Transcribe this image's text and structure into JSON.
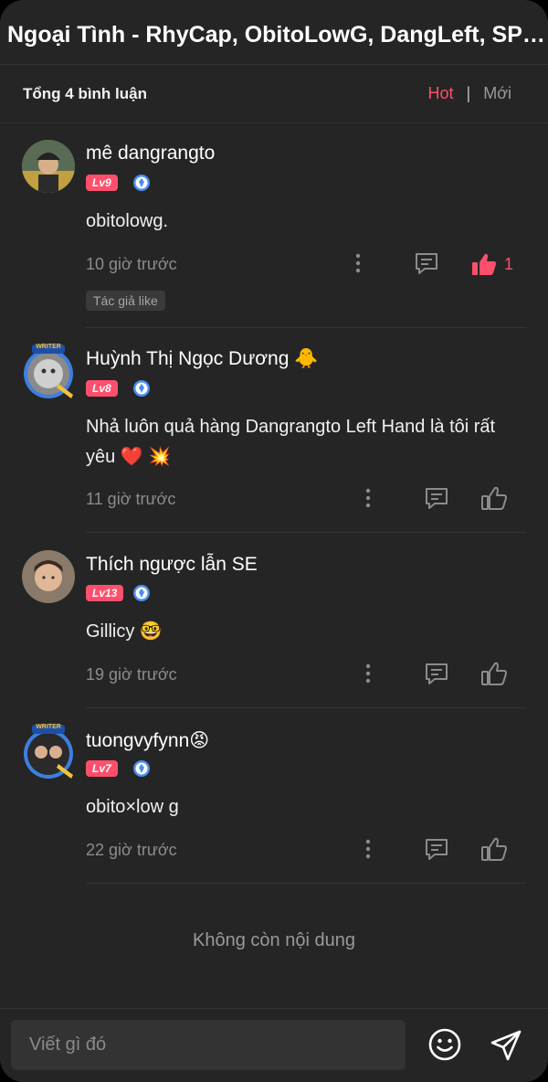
{
  "header": {
    "title": "Ngoại Tình - RhyCap, ObitoLowG, DangLeft, SPIDEYBOY"
  },
  "toolbar": {
    "count_label": "Tổng 4 bình luận",
    "sort_hot": "Hot",
    "sort_sep": "|",
    "sort_new": "Mới"
  },
  "comments": [
    {
      "name": "mê dangrangto",
      "level": "Lv9",
      "text": "obitolowg.",
      "time": "10 giờ trước",
      "like_count": "1",
      "liked": true,
      "author_tag": "Tác giả like"
    },
    {
      "name": "Huỳnh Thị Ngọc Dương 🐥",
      "level": "Lv8",
      "text": "Nhả luôn quả hàng Dangrangto Left Hand là tôi rất yêu ❤️ 💥",
      "time": "11 giờ trước",
      "liked": false,
      "avatar_badge": "WRITER"
    },
    {
      "name": "Thích ngược lẫn SE",
      "level": "Lv13",
      "text": "Gillicy 🤓",
      "time": "19 giờ trước",
      "liked": false
    },
    {
      "name": "tuongvyfynn😡",
      "level": "Lv7",
      "text": "obito×low g",
      "time": "22 giờ trước",
      "liked": false,
      "avatar_badge": "WRITER"
    }
  ],
  "footer": {
    "end_text": "Không còn nội dung"
  },
  "composer": {
    "placeholder": "Viết gì đó"
  },
  "icons": {
    "more": "more-vertical-icon",
    "reply": "comment-icon",
    "like": "thumbs-up-icon",
    "shield": "shield-badge-icon",
    "emoji": "smiley-icon",
    "send": "send-icon"
  },
  "colors": {
    "accent": "#ff4f6d",
    "background": "#252525",
    "shield": "#4a8ef0"
  }
}
